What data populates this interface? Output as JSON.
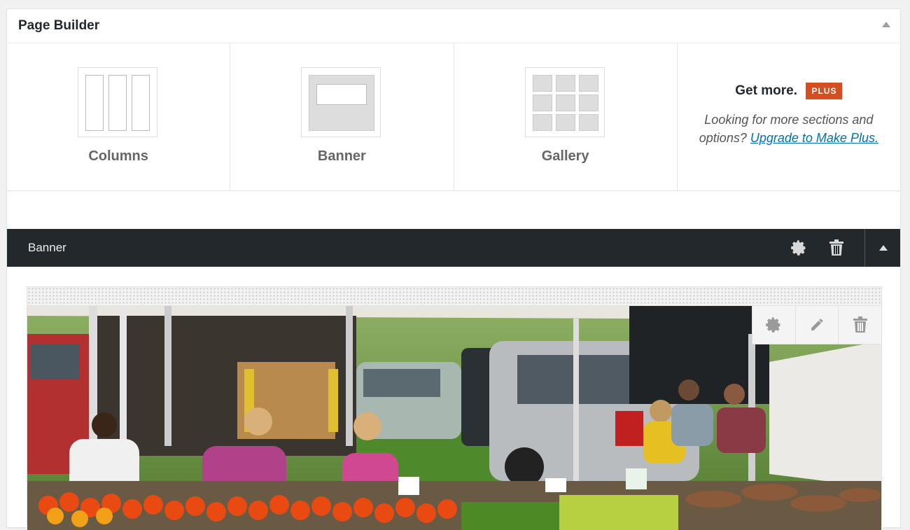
{
  "panel": {
    "title": "Page Builder"
  },
  "menu": {
    "items": [
      {
        "label": "Columns",
        "icon": "columns-icon"
      },
      {
        "label": "Banner",
        "icon": "banner-icon"
      },
      {
        "label": "Gallery",
        "icon": "gallery-icon"
      }
    ],
    "get_more": {
      "title": "Get more.",
      "badge": "PLUS",
      "text": "Looking for more sections and options?",
      "link": "Upgrade to Make Plus."
    }
  },
  "section": {
    "title": "Banner",
    "icons": [
      "gear-icon",
      "trash-icon",
      "collapse-icon"
    ],
    "slide_tools": [
      "gear-icon",
      "pencil-icon",
      "trash-icon"
    ]
  },
  "colors": {
    "accent_badge": "#d54e21",
    "link": "#0073aa",
    "bar": "#23282d"
  }
}
